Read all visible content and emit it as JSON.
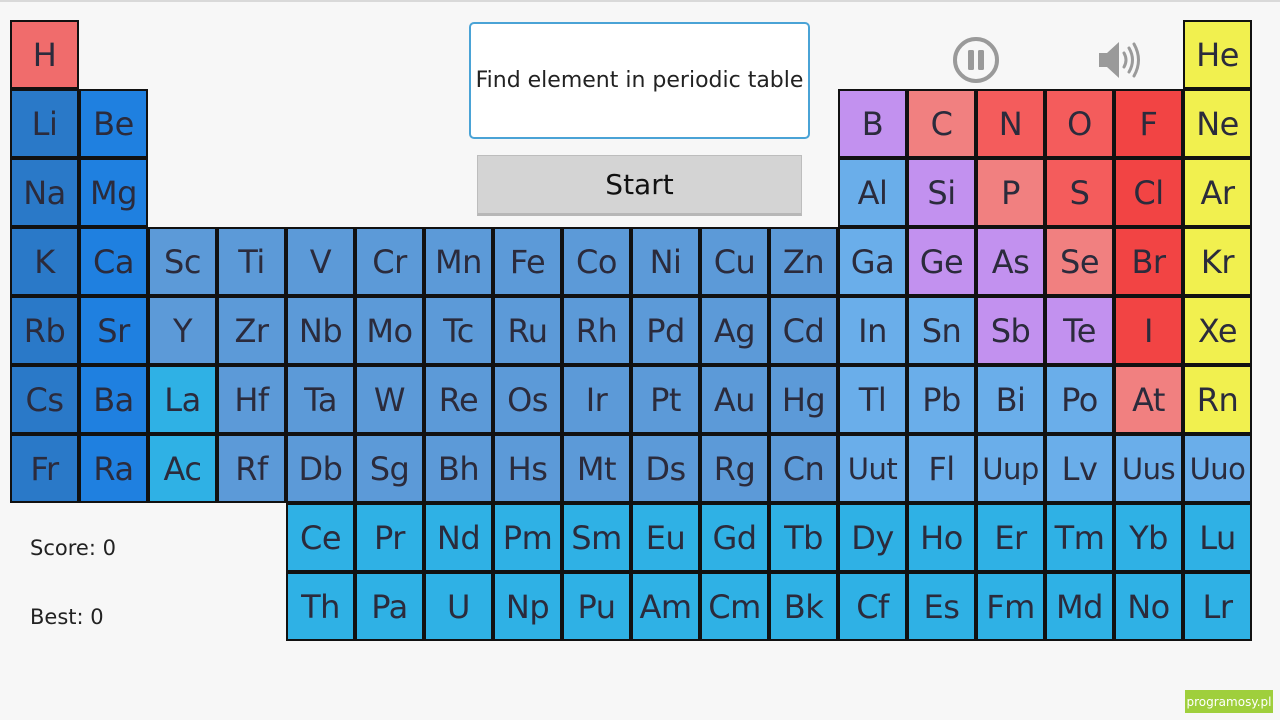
{
  "prompt": {
    "text": "Find element in periodic table"
  },
  "start_button": {
    "label": "Start"
  },
  "score": {
    "score_label": "Score: 0",
    "best_label": "Best: 0"
  },
  "watermark": {
    "text": "programosy.pl"
  },
  "icons": {
    "pause": "pause-icon",
    "sound": "speaker-icon"
  },
  "colors": {
    "alkali": "#2a79c8",
    "alkaline": "#1f80e0",
    "transition": "#5c9ad8",
    "lanthanum_actinium": "#2fb1e5",
    "post_transition": "#6aaeea",
    "metalloid": "#c291ef",
    "nonmetal": "#f18080",
    "nonmetal_dark": "#f45c5c",
    "halogen": "#f24444",
    "noble": "#f1f04f",
    "f_block": "#2fb1e5",
    "hydrogen": "#f06c6c"
  },
  "elements": [
    {
      "symbol": "H",
      "row": 0,
      "col": 0,
      "group": "hydrogen"
    },
    {
      "symbol": "He",
      "row": 0,
      "col": 17,
      "group": "noble"
    },
    {
      "symbol": "Li",
      "row": 1,
      "col": 0,
      "group": "alkali"
    },
    {
      "symbol": "Be",
      "row": 1,
      "col": 1,
      "group": "alkaline"
    },
    {
      "symbol": "B",
      "row": 1,
      "col": 12,
      "group": "metalloid"
    },
    {
      "symbol": "C",
      "row": 1,
      "col": 13,
      "group": "nonmetal"
    },
    {
      "symbol": "N",
      "row": 1,
      "col": 14,
      "group": "nonmetal_dark"
    },
    {
      "symbol": "O",
      "row": 1,
      "col": 15,
      "group": "nonmetal_dark"
    },
    {
      "symbol": "F",
      "row": 1,
      "col": 16,
      "group": "halogen"
    },
    {
      "symbol": "Ne",
      "row": 1,
      "col": 17,
      "group": "noble"
    },
    {
      "symbol": "Na",
      "row": 2,
      "col": 0,
      "group": "alkali"
    },
    {
      "symbol": "Mg",
      "row": 2,
      "col": 1,
      "group": "alkaline"
    },
    {
      "symbol": "Al",
      "row": 2,
      "col": 12,
      "group": "post_transition"
    },
    {
      "symbol": "Si",
      "row": 2,
      "col": 13,
      "group": "metalloid"
    },
    {
      "symbol": "P",
      "row": 2,
      "col": 14,
      "group": "nonmetal"
    },
    {
      "symbol": "S",
      "row": 2,
      "col": 15,
      "group": "nonmetal_dark"
    },
    {
      "symbol": "Cl",
      "row": 2,
      "col": 16,
      "group": "halogen"
    },
    {
      "symbol": "Ar",
      "row": 2,
      "col": 17,
      "group": "noble"
    },
    {
      "symbol": "K",
      "row": 3,
      "col": 0,
      "group": "alkali"
    },
    {
      "symbol": "Ca",
      "row": 3,
      "col": 1,
      "group": "alkaline"
    },
    {
      "symbol": "Sc",
      "row": 3,
      "col": 2,
      "group": "transition"
    },
    {
      "symbol": "Ti",
      "row": 3,
      "col": 3,
      "group": "transition"
    },
    {
      "symbol": "V",
      "row": 3,
      "col": 4,
      "group": "transition"
    },
    {
      "symbol": "Cr",
      "row": 3,
      "col": 5,
      "group": "transition"
    },
    {
      "symbol": "Mn",
      "row": 3,
      "col": 6,
      "group": "transition"
    },
    {
      "symbol": "Fe",
      "row": 3,
      "col": 7,
      "group": "transition"
    },
    {
      "symbol": "Co",
      "row": 3,
      "col": 8,
      "group": "transition"
    },
    {
      "symbol": "Ni",
      "row": 3,
      "col": 9,
      "group": "transition"
    },
    {
      "symbol": "Cu",
      "row": 3,
      "col": 10,
      "group": "transition"
    },
    {
      "symbol": "Zn",
      "row": 3,
      "col": 11,
      "group": "transition"
    },
    {
      "symbol": "Ga",
      "row": 3,
      "col": 12,
      "group": "post_transition"
    },
    {
      "symbol": "Ge",
      "row": 3,
      "col": 13,
      "group": "metalloid"
    },
    {
      "symbol": "As",
      "row": 3,
      "col": 14,
      "group": "metalloid"
    },
    {
      "symbol": "Se",
      "row": 3,
      "col": 15,
      "group": "nonmetal"
    },
    {
      "symbol": "Br",
      "row": 3,
      "col": 16,
      "group": "halogen"
    },
    {
      "symbol": "Kr",
      "row": 3,
      "col": 17,
      "group": "noble"
    },
    {
      "symbol": "Rb",
      "row": 4,
      "col": 0,
      "group": "alkali"
    },
    {
      "symbol": "Sr",
      "row": 4,
      "col": 1,
      "group": "alkaline"
    },
    {
      "symbol": "Y",
      "row": 4,
      "col": 2,
      "group": "transition"
    },
    {
      "symbol": "Zr",
      "row": 4,
      "col": 3,
      "group": "transition"
    },
    {
      "symbol": "Nb",
      "row": 4,
      "col": 4,
      "group": "transition"
    },
    {
      "symbol": "Mo",
      "row": 4,
      "col": 5,
      "group": "transition"
    },
    {
      "symbol": "Tc",
      "row": 4,
      "col": 6,
      "group": "transition"
    },
    {
      "symbol": "Ru",
      "row": 4,
      "col": 7,
      "group": "transition"
    },
    {
      "symbol": "Rh",
      "row": 4,
      "col": 8,
      "group": "transition"
    },
    {
      "symbol": "Pd",
      "row": 4,
      "col": 9,
      "group": "transition"
    },
    {
      "symbol": "Ag",
      "row": 4,
      "col": 10,
      "group": "transition"
    },
    {
      "symbol": "Cd",
      "row": 4,
      "col": 11,
      "group": "transition"
    },
    {
      "symbol": "In",
      "row": 4,
      "col": 12,
      "group": "post_transition"
    },
    {
      "symbol": "Sn",
      "row": 4,
      "col": 13,
      "group": "post_transition"
    },
    {
      "symbol": "Sb",
      "row": 4,
      "col": 14,
      "group": "metalloid"
    },
    {
      "symbol": "Te",
      "row": 4,
      "col": 15,
      "group": "metalloid"
    },
    {
      "symbol": "I",
      "row": 4,
      "col": 16,
      "group": "halogen"
    },
    {
      "symbol": "Xe",
      "row": 4,
      "col": 17,
      "group": "noble"
    },
    {
      "symbol": "Cs",
      "row": 5,
      "col": 0,
      "group": "alkali"
    },
    {
      "symbol": "Ba",
      "row": 5,
      "col": 1,
      "group": "alkaline"
    },
    {
      "symbol": "La",
      "row": 5,
      "col": 2,
      "group": "lanthanum_actinium"
    },
    {
      "symbol": "Hf",
      "row": 5,
      "col": 3,
      "group": "transition"
    },
    {
      "symbol": "Ta",
      "row": 5,
      "col": 4,
      "group": "transition"
    },
    {
      "symbol": "W",
      "row": 5,
      "col": 5,
      "group": "transition"
    },
    {
      "symbol": "Re",
      "row": 5,
      "col": 6,
      "group": "transition"
    },
    {
      "symbol": "Os",
      "row": 5,
      "col": 7,
      "group": "transition"
    },
    {
      "symbol": "Ir",
      "row": 5,
      "col": 8,
      "group": "transition"
    },
    {
      "symbol": "Pt",
      "row": 5,
      "col": 9,
      "group": "transition"
    },
    {
      "symbol": "Au",
      "row": 5,
      "col": 10,
      "group": "transition"
    },
    {
      "symbol": "Hg",
      "row": 5,
      "col": 11,
      "group": "transition"
    },
    {
      "symbol": "Tl",
      "row": 5,
      "col": 12,
      "group": "post_transition"
    },
    {
      "symbol": "Pb",
      "row": 5,
      "col": 13,
      "group": "post_transition"
    },
    {
      "symbol": "Bi",
      "row": 5,
      "col": 14,
      "group": "post_transition"
    },
    {
      "symbol": "Po",
      "row": 5,
      "col": 15,
      "group": "post_transition"
    },
    {
      "symbol": "At",
      "row": 5,
      "col": 16,
      "group": "nonmetal"
    },
    {
      "symbol": "Rn",
      "row": 5,
      "col": 17,
      "group": "noble"
    },
    {
      "symbol": "Fr",
      "row": 6,
      "col": 0,
      "group": "alkali"
    },
    {
      "symbol": "Ra",
      "row": 6,
      "col": 1,
      "group": "alkaline"
    },
    {
      "symbol": "Ac",
      "row": 6,
      "col": 2,
      "group": "lanthanum_actinium"
    },
    {
      "symbol": "Rf",
      "row": 6,
      "col": 3,
      "group": "transition"
    },
    {
      "symbol": "Db",
      "row": 6,
      "col": 4,
      "group": "transition"
    },
    {
      "symbol": "Sg",
      "row": 6,
      "col": 5,
      "group": "transition"
    },
    {
      "symbol": "Bh",
      "row": 6,
      "col": 6,
      "group": "transition"
    },
    {
      "symbol": "Hs",
      "row": 6,
      "col": 7,
      "group": "transition"
    },
    {
      "symbol": "Mt",
      "row": 6,
      "col": 8,
      "group": "transition"
    },
    {
      "symbol": "Ds",
      "row": 6,
      "col": 9,
      "group": "transition"
    },
    {
      "symbol": "Rg",
      "row": 6,
      "col": 10,
      "group": "transition"
    },
    {
      "symbol": "Cn",
      "row": 6,
      "col": 11,
      "group": "transition"
    },
    {
      "symbol": "Uut",
      "row": 6,
      "col": 12,
      "group": "post_transition"
    },
    {
      "symbol": "Fl",
      "row": 6,
      "col": 13,
      "group": "post_transition"
    },
    {
      "symbol": "Uup",
      "row": 6,
      "col": 14,
      "group": "post_transition"
    },
    {
      "symbol": "Lv",
      "row": 6,
      "col": 15,
      "group": "post_transition"
    },
    {
      "symbol": "Uus",
      "row": 6,
      "col": 16,
      "group": "post_transition"
    },
    {
      "symbol": "Uuo",
      "row": 6,
      "col": 17,
      "group": "post_transition"
    },
    {
      "symbol": "Ce",
      "row": 7,
      "col": 4,
      "group": "f_block"
    },
    {
      "symbol": "Pr",
      "row": 7,
      "col": 5,
      "group": "f_block"
    },
    {
      "symbol": "Nd",
      "row": 7,
      "col": 6,
      "group": "f_block"
    },
    {
      "symbol": "Pm",
      "row": 7,
      "col": 7,
      "group": "f_block"
    },
    {
      "symbol": "Sm",
      "row": 7,
      "col": 8,
      "group": "f_block"
    },
    {
      "symbol": "Eu",
      "row": 7,
      "col": 9,
      "group": "f_block"
    },
    {
      "symbol": "Gd",
      "row": 7,
      "col": 10,
      "group": "f_block"
    },
    {
      "symbol": "Tb",
      "row": 7,
      "col": 11,
      "group": "f_block"
    },
    {
      "symbol": "Dy",
      "row": 7,
      "col": 12,
      "group": "f_block"
    },
    {
      "symbol": "Ho",
      "row": 7,
      "col": 13,
      "group": "f_block"
    },
    {
      "symbol": "Er",
      "row": 7,
      "col": 14,
      "group": "f_block"
    },
    {
      "symbol": "Tm",
      "row": 7,
      "col": 15,
      "group": "f_block"
    },
    {
      "symbol": "Yb",
      "row": 7,
      "col": 16,
      "group": "f_block"
    },
    {
      "symbol": "Lu",
      "row": 7,
      "col": 17,
      "group": "f_block"
    },
    {
      "symbol": "Th",
      "row": 8,
      "col": 4,
      "group": "f_block"
    },
    {
      "symbol": "Pa",
      "row": 8,
      "col": 5,
      "group": "f_block"
    },
    {
      "symbol": "U",
      "row": 8,
      "col": 6,
      "group": "f_block"
    },
    {
      "symbol": "Np",
      "row": 8,
      "col": 7,
      "group": "f_block"
    },
    {
      "symbol": "Pu",
      "row": 8,
      "col": 8,
      "group": "f_block"
    },
    {
      "symbol": "Am",
      "row": 8,
      "col": 9,
      "group": "f_block"
    },
    {
      "symbol": "Cm",
      "row": 8,
      "col": 10,
      "group": "f_block"
    },
    {
      "symbol": "Bk",
      "row": 8,
      "col": 11,
      "group": "f_block"
    },
    {
      "symbol": "Cf",
      "row": 8,
      "col": 12,
      "group": "f_block"
    },
    {
      "symbol": "Es",
      "row": 8,
      "col": 13,
      "group": "f_block"
    },
    {
      "symbol": "Fm",
      "row": 8,
      "col": 14,
      "group": "f_block"
    },
    {
      "symbol": "Md",
      "row": 8,
      "col": 15,
      "group": "f_block"
    },
    {
      "symbol": "No",
      "row": 8,
      "col": 16,
      "group": "f_block"
    },
    {
      "symbol": "Lr",
      "row": 8,
      "col": 17,
      "group": "f_block"
    }
  ]
}
